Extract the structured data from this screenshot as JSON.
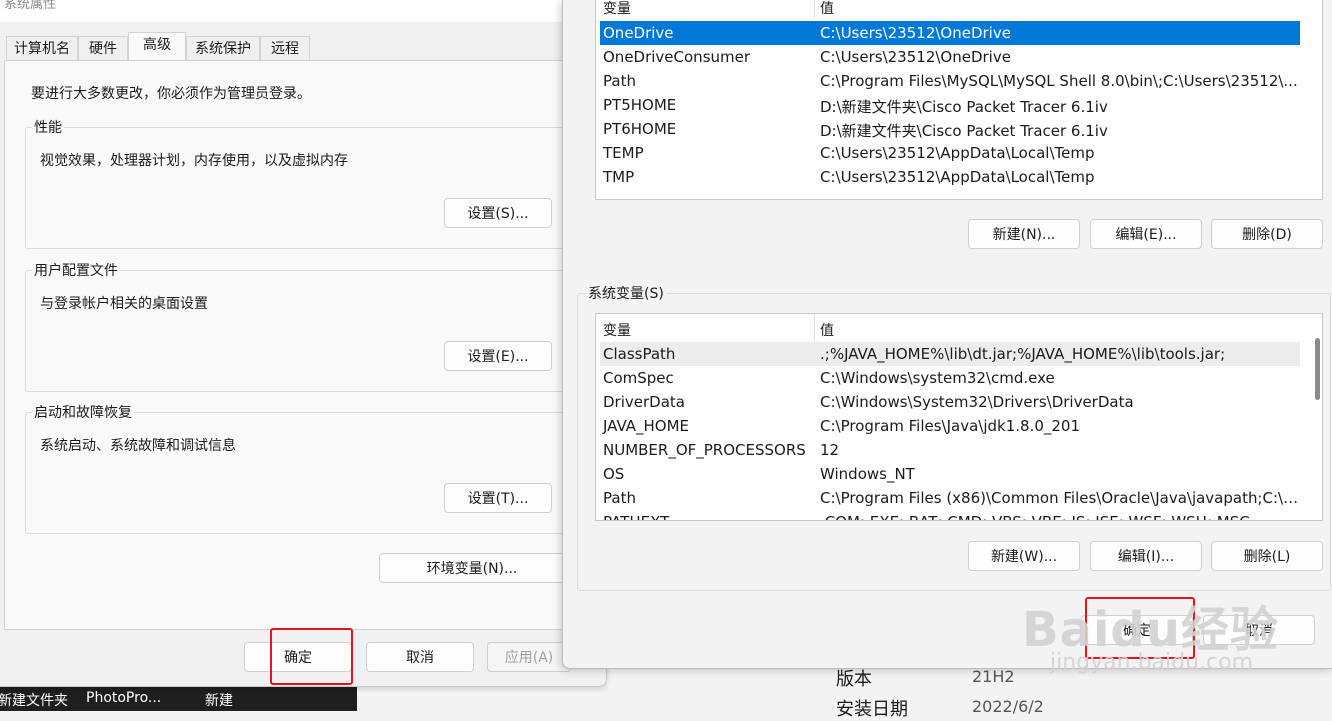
{
  "system_properties": {
    "title": "系统属性",
    "tabs": [
      "计算机名",
      "硬件",
      "高级",
      "系统保护",
      "远程"
    ],
    "active_tab": "高级",
    "admin_notice": "要进行大多数更改，你必须作为管理员登录。",
    "performance": {
      "label": "性能",
      "description": "视觉效果，处理器计划，内存使用，以及虚拟内存",
      "button": "设置(S)..."
    },
    "user_profiles": {
      "label": "用户配置文件",
      "description": "与登录帐户相关的桌面设置",
      "button": "设置(E)..."
    },
    "startup_recovery": {
      "label": "启动和故障恢复",
      "description": "系统启动、系统故障和调试信息",
      "button": "设置(T)..."
    },
    "env_button": "环境变量(N)...",
    "ok": "确定",
    "cancel": "取消",
    "apply": "应用(A)"
  },
  "environment_variables": {
    "user_vars": {
      "columns": [
        "变量",
        "值"
      ],
      "rows": [
        {
          "name": "OneDrive",
          "value": "C:\\Users\\23512\\OneDrive",
          "selected": true
        },
        {
          "name": "OneDriveConsumer",
          "value": "C:\\Users\\23512\\OneDrive"
        },
        {
          "name": "Path",
          "value": "C:\\Program Files\\MySQL\\MySQL Shell 8.0\\bin\\;C:\\Users\\23512\\..."
        },
        {
          "name": "PT5HOME",
          "value": "D:\\新建文件夹\\Cisco Packet Tracer 6.1iv"
        },
        {
          "name": "PT6HOME",
          "value": "D:\\新建文件夹\\Cisco Packet Tracer 6.1iv"
        },
        {
          "name": "TEMP",
          "value": "C:\\Users\\23512\\AppData\\Local\\Temp"
        },
        {
          "name": "TMP",
          "value": "C:\\Users\\23512\\AppData\\Local\\Temp"
        }
      ],
      "buttons": {
        "new": "新建(N)...",
        "edit": "编辑(E)...",
        "delete": "删除(D)"
      }
    },
    "system_vars": {
      "label": "系统变量(S)",
      "columns": [
        "变量",
        "值"
      ],
      "rows": [
        {
          "name": "ClassPath",
          "value": ".;%JAVA_HOME%\\lib\\dt.jar;%JAVA_HOME%\\lib\\tools.jar;",
          "highlighted": true
        },
        {
          "name": "ComSpec",
          "value": "C:\\Windows\\system32\\cmd.exe"
        },
        {
          "name": "DriverData",
          "value": "C:\\Windows\\System32\\Drivers\\DriverData"
        },
        {
          "name": "JAVA_HOME",
          "value": "C:\\Program Files\\Java\\jdk1.8.0_201"
        },
        {
          "name": "NUMBER_OF_PROCESSORS",
          "value": "12"
        },
        {
          "name": "OS",
          "value": "Windows_NT"
        },
        {
          "name": "Path",
          "value": "C:\\Program Files (x86)\\Common Files\\Oracle\\Java\\javapath;C:\\W..."
        },
        {
          "name": "PATHEXT",
          "value": ".COM;.EXE;.BAT;.CMD;.VBS;.VBE;.JS;.JSE;.WSF;.WSH;.MSC"
        }
      ],
      "buttons": {
        "new": "新建(W)...",
        "edit": "编辑(I)...",
        "delete": "删除(L)"
      }
    },
    "ok": "确定",
    "cancel": "取消"
  },
  "background": {
    "version_label": "版本",
    "version_value": "21H2",
    "install_label": "安装日期",
    "install_value": "2022/6/2"
  },
  "taskbar": {
    "items": [
      "新建文件夹",
      "PhotoPro...",
      "新建"
    ]
  },
  "watermark": {
    "logo": "Baidu经验",
    "url": "jingyan.baidu.com"
  },
  "colors": {
    "selection": "#0078d7",
    "highlight_box": "#e8141c"
  }
}
